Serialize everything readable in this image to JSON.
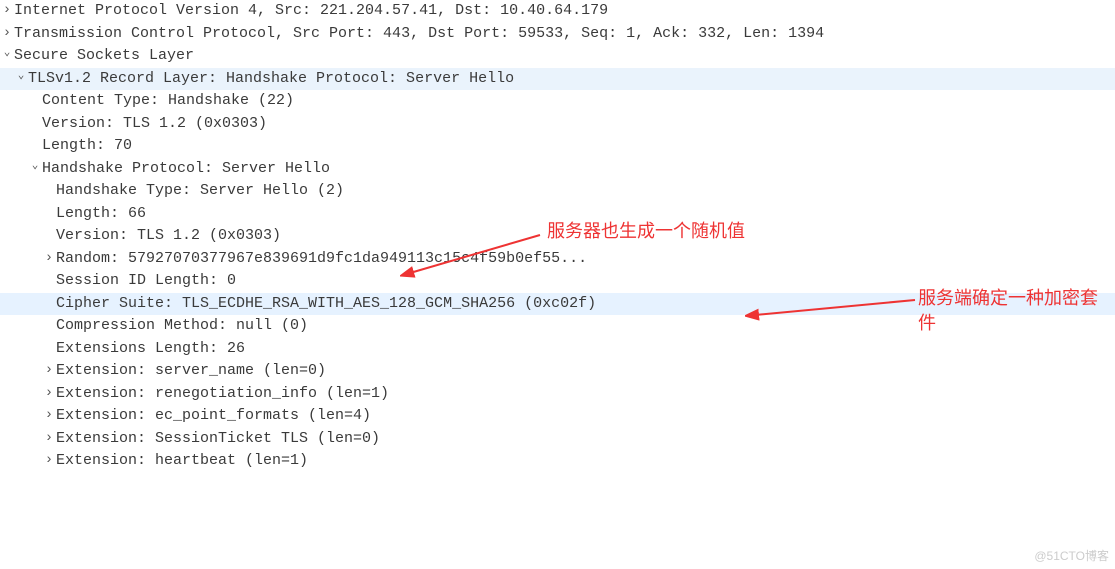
{
  "rows": [
    {
      "indent": 0,
      "caret": "closed",
      "highlight": "",
      "text": "Internet Protocol Version 4, Src: 221.204.57.41, Dst: 10.40.64.179"
    },
    {
      "indent": 0,
      "caret": "closed",
      "highlight": "",
      "text": "Transmission Control Protocol, Src Port: 443, Dst Port: 59533, Seq: 1, Ack: 332, Len: 1394"
    },
    {
      "indent": 0,
      "caret": "open",
      "highlight": "",
      "text": "Secure Sockets Layer"
    },
    {
      "indent": 1,
      "caret": "open",
      "highlight": "highlight-light",
      "text": "TLSv1.2 Record Layer: Handshake Protocol: Server Hello"
    },
    {
      "indent": 2,
      "caret": "none",
      "highlight": "",
      "text": "Content Type: Handshake (22)"
    },
    {
      "indent": 2,
      "caret": "none",
      "highlight": "",
      "text": "Version: TLS 1.2 (0x0303)"
    },
    {
      "indent": 2,
      "caret": "none",
      "highlight": "",
      "text": "Length: 70"
    },
    {
      "indent": 2,
      "caret": "open",
      "highlight": "",
      "text": "Handshake Protocol: Server Hello"
    },
    {
      "indent": 3,
      "caret": "none",
      "highlight": "",
      "text": "Handshake Type: Server Hello (2)"
    },
    {
      "indent": 3,
      "caret": "none",
      "highlight": "",
      "text": "Length: 66"
    },
    {
      "indent": 3,
      "caret": "none",
      "highlight": "",
      "text": "Version: TLS 1.2 (0x0303)"
    },
    {
      "indent": 3,
      "caret": "closed",
      "highlight": "",
      "text": "Random: 57927070377967e839691d9fc1da949113c15c4f59b0ef55..."
    },
    {
      "indent": 3,
      "caret": "none",
      "highlight": "",
      "text": "Session ID Length: 0"
    },
    {
      "indent": 3,
      "caret": "none",
      "highlight": "highlight",
      "text": "Cipher Suite: TLS_ECDHE_RSA_WITH_AES_128_GCM_SHA256 (0xc02f)"
    },
    {
      "indent": 3,
      "caret": "none",
      "highlight": "",
      "text": "Compression Method: null (0)"
    },
    {
      "indent": 3,
      "caret": "none",
      "highlight": "",
      "text": "Extensions Length: 26"
    },
    {
      "indent": 3,
      "caret": "closed",
      "highlight": "",
      "text": "Extension: server_name (len=0)"
    },
    {
      "indent": 3,
      "caret": "closed",
      "highlight": "",
      "text": "Extension: renegotiation_info (len=1)"
    },
    {
      "indent": 3,
      "caret": "closed",
      "highlight": "",
      "text": "Extension: ec_point_formats (len=4)"
    },
    {
      "indent": 3,
      "caret": "closed",
      "highlight": "",
      "text": "Extension: SessionTicket TLS (len=0)"
    },
    {
      "indent": 3,
      "caret": "closed",
      "highlight": "",
      "text": "Extension: heartbeat (len=1)"
    }
  ],
  "annotations": {
    "a1": "服务器也生成一个随机值",
    "a2_line1": "服务端确定一种加密套",
    "a2_line2": "件"
  },
  "watermark": "@51CTO博客"
}
